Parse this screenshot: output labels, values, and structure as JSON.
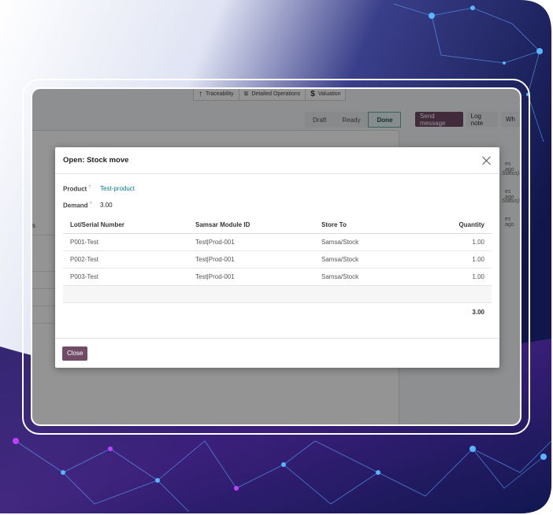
{
  "colors": {
    "accent": "#714b67",
    "link": "#017e84",
    "background_dark": "#141a52"
  },
  "smart_buttons": [
    {
      "icon": "arrow-up-icon",
      "label": "Traceability"
    },
    {
      "icon": "list-icon",
      "label": "Detailed Operations"
    },
    {
      "icon": "dollar-icon",
      "label": "Valuation"
    }
  ],
  "statusbar": {
    "steps": [
      "Draft",
      "Ready",
      "Done"
    ],
    "active": "Done"
  },
  "chatter": {
    "send_message": "Send message",
    "log_note": "Log note",
    "whatsapp_partial": "Wh",
    "entries": [
      {
        "time": "es ago",
        "text": "Status)"
      },
      {
        "time": "es ago",
        "text": "Status)"
      },
      {
        "time": "es ago",
        "text": ""
      }
    ]
  },
  "sheet": {
    "partial_label": "s"
  },
  "modal": {
    "title": "Open: Stock move",
    "product_label": "Product",
    "product_help": "?",
    "product_value": "Test-product",
    "demand_label": "Demand",
    "demand_help": "?",
    "demand_value": "3.00",
    "columns": [
      "Lot/Serial Number",
      "Samsar Module ID",
      "Store To",
      "Quantity"
    ],
    "rows": [
      {
        "lot": "P001-Test",
        "module": "Test|Prod-001",
        "store": "Samsa/Stock",
        "qty": "1.00"
      },
      {
        "lot": "P002-Test",
        "module": "Test|Prod-001",
        "store": "Samsa/Stock",
        "qty": "1.00"
      },
      {
        "lot": "P003-Test",
        "module": "Test|Prod-001",
        "store": "Samsa/Stock",
        "qty": "1.00"
      }
    ],
    "total_quantity": "3.00",
    "close_label": "Close"
  }
}
